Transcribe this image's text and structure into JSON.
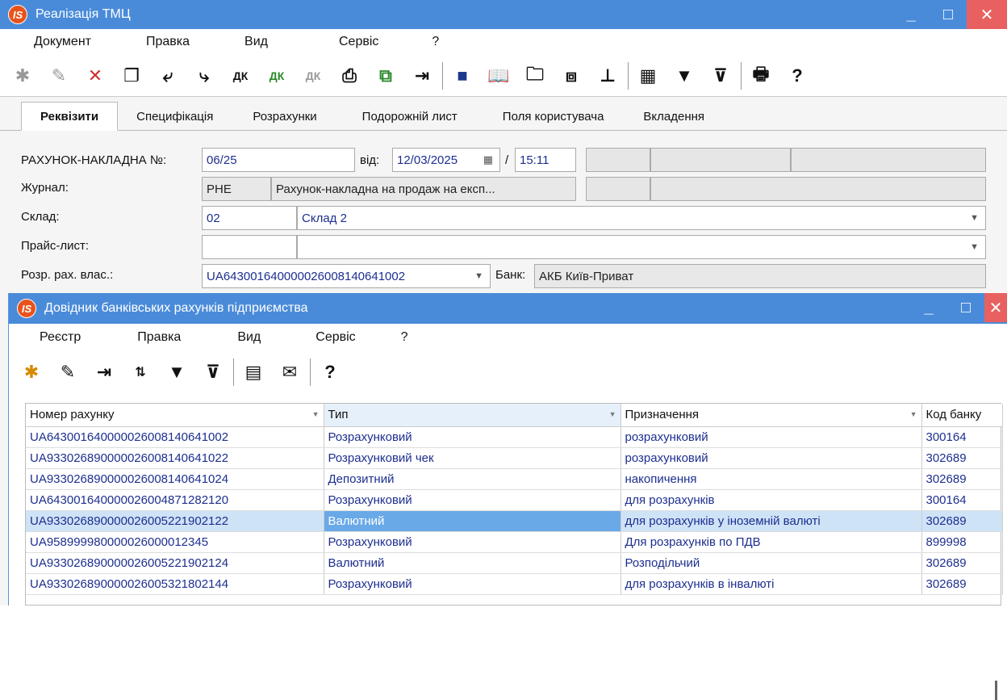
{
  "main_window": {
    "title": "Реалізація ТМЦ",
    "menu": [
      "Документ",
      "Правка",
      "Вид",
      "Сервіс",
      "?"
    ],
    "tabs": [
      "Реквізити",
      "Специфікація",
      "Розрахунки",
      "Подорожній лист",
      "Поля користувача",
      "Вкладення"
    ],
    "form": {
      "invoice_label": "РАХУНОК-НАКЛАДНА №:",
      "invoice_number": "06/25",
      "from_label": "від:",
      "date": "12/03/2025",
      "slash": "/",
      "time": "15:11",
      "journal_label": "Журнал:",
      "journal_code": "РНЕ",
      "journal_name": "Рахунок-накладна на продаж на експ...",
      "warehouse_label": "Склад:",
      "warehouse_code": "02",
      "warehouse_name": "Склад 2",
      "pricelist_label": "Прайс-лист:",
      "account_label": "Розр. рах. влас.:",
      "account_value": "UA643001640000026008140641002",
      "bank_label": "Банк:",
      "bank_value": "АКБ Київ-Приват"
    }
  },
  "dialog": {
    "title": "Довідник банківських рахунків підприємства",
    "menu": [
      "Реєстр",
      "Правка",
      "Вид",
      "Сервіс",
      "?"
    ],
    "columns": [
      "Номер рахунку",
      "Тип",
      "Призначення",
      "Код банку"
    ],
    "rows": [
      [
        "UA643001640000026008140641002",
        "Розрахунковий",
        "розрахунковий",
        "300164"
      ],
      [
        "UA933026890000026008140641022",
        "Розрахунковий чек",
        "розрахунковий",
        "302689"
      ],
      [
        "UA933026890000026008140641024",
        "Депозитний",
        "накопичення",
        "302689"
      ],
      [
        "UA643001640000026004871282120",
        "Розрахунковий",
        "для розрахунків",
        "300164"
      ],
      [
        "UA933026890000026005221902122",
        "Валютний",
        "для розрахунків у іноземній валюті",
        "302689"
      ],
      [
        "UA958999980000026000012345",
        "Розрахунковий",
        "Для розрахунків по ПДВ",
        "899998"
      ],
      [
        "UA933026890000026005221902124",
        "Валютний",
        "Розподільчий",
        "302689"
      ],
      [
        "UA933026890000026005321802144",
        "Розрахунковий",
        "для розрахунків в інвалюті",
        "302689"
      ]
    ],
    "selected_row": 4
  },
  "logo_text": "IS",
  "colors": {
    "titlebar": "#4a8bd9",
    "link_text": "#1d2f8f",
    "selection": "#6aa9e8"
  }
}
